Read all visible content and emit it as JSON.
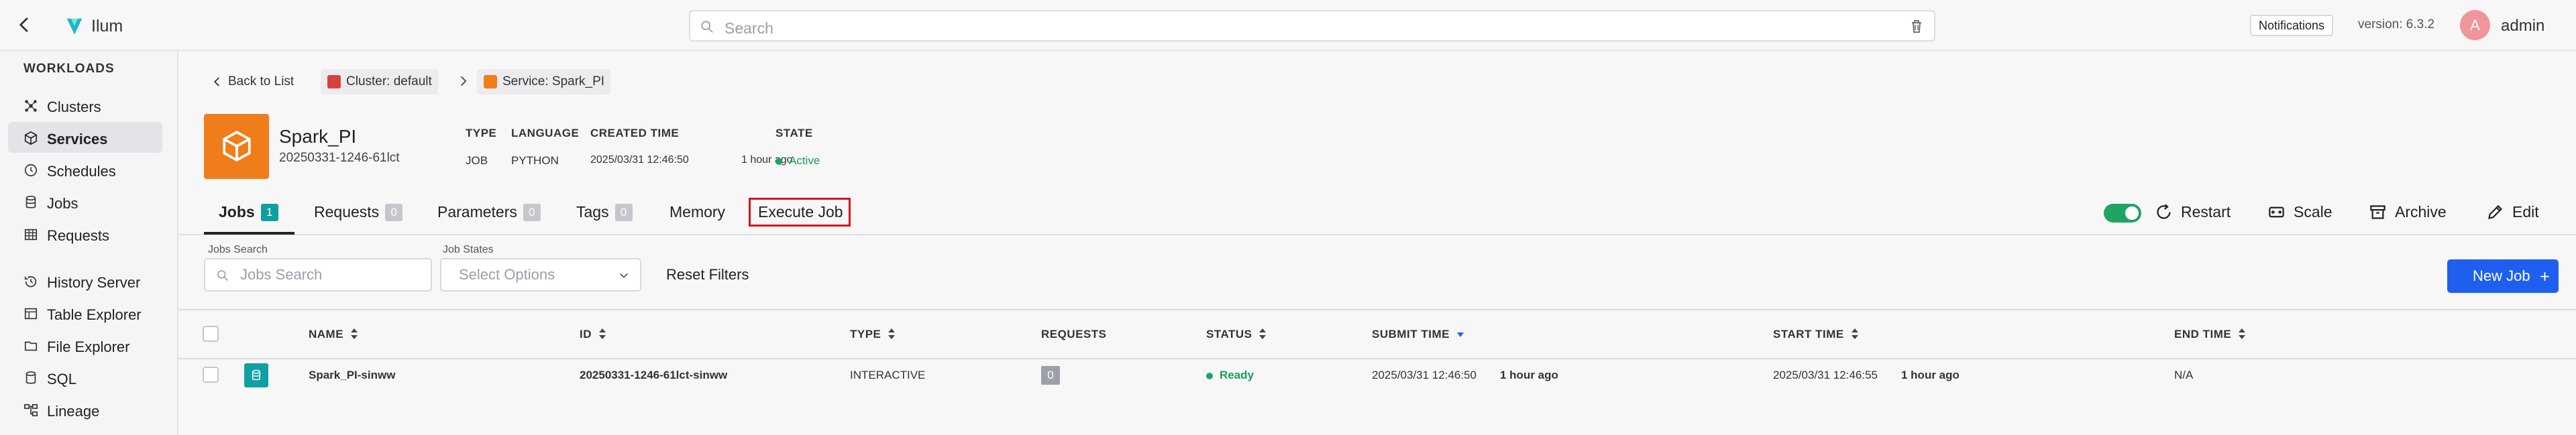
{
  "header": {
    "app_name": "Ilum",
    "search_placeholder": "Search",
    "notifications_label": "Notifications",
    "version": "version: 6.3.2",
    "avatar_initial": "A",
    "user": "admin"
  },
  "sidebar": {
    "section_title": "WORKLOADS",
    "items": [
      {
        "label": "Clusters",
        "icon": "clusters-icon"
      },
      {
        "label": "Services",
        "icon": "box-icon",
        "active": true
      },
      {
        "label": "Schedules",
        "icon": "clock-icon"
      },
      {
        "label": "Jobs",
        "icon": "database-icon"
      },
      {
        "label": "Requests",
        "icon": "table-icon"
      },
      {
        "label": "History Server",
        "icon": "history-icon"
      },
      {
        "label": "Table Explorer",
        "icon": "table-explorer-icon"
      },
      {
        "label": "File Explorer",
        "icon": "folder-icon"
      },
      {
        "label": "SQL",
        "icon": "sql-icon"
      },
      {
        "label": "Lineage",
        "icon": "lineage-icon"
      }
    ]
  },
  "breadcrumb": {
    "back": "Back to List",
    "cluster": "Cluster: default",
    "service": "Service: Spark_PI"
  },
  "service": {
    "name": "Spark_PI",
    "id": "20250331-1246-61lct",
    "meta_headers": {
      "type": "TYPE",
      "language": "LANGUAGE",
      "created": "CREATED TIME",
      "state": "STATE"
    },
    "type": "JOB",
    "language": "PYTHON",
    "created_time": "2025/03/31  12:46:50",
    "created_ago": "1 hour ago",
    "state": "Active",
    "state_color": "#1fa463"
  },
  "tabs": {
    "jobs": "Jobs",
    "jobs_count": "1",
    "requests": "Requests",
    "requests_count": "0",
    "parameters": "Parameters",
    "parameters_count": "0",
    "tags": "Tags",
    "tags_count": "0",
    "memory": "Memory",
    "execute_job": "Execute Job"
  },
  "actions": {
    "restart": "Restart",
    "scale": "Scale",
    "archive": "Archive",
    "edit": "Edit"
  },
  "filters": {
    "jobs_search_label": "Jobs Search",
    "jobs_search_placeholder": "Jobs Search",
    "job_states_label": "Job States",
    "job_states_placeholder": "Select Options",
    "reset": "Reset Filters",
    "new_job": "New Job"
  },
  "table": {
    "columns": {
      "name": "NAME",
      "id": "ID",
      "type": "TYPE",
      "requests": "REQUESTS",
      "status": "STATUS",
      "submit": "SUBMIT TIME",
      "start": "START TIME",
      "end": "END TIME"
    },
    "rows": [
      {
        "name": "Spark_PI-sinww",
        "id": "20250331-1246-61lct-sinww",
        "type": "INTERACTIVE",
        "requests": "0",
        "status": "Ready",
        "submit_date": "2025/03/31  12:46:50",
        "submit_ago": "1 hour ago",
        "start_date": "2025/03/31  12:46:55",
        "start_ago": "1 hour ago",
        "end": "N/A"
      }
    ]
  },
  "colors": {
    "accent": "#1f5ff0",
    "service_icon": "#ef7d1a",
    "teal": "#0e9fa0",
    "highlight": "#d8141b"
  }
}
